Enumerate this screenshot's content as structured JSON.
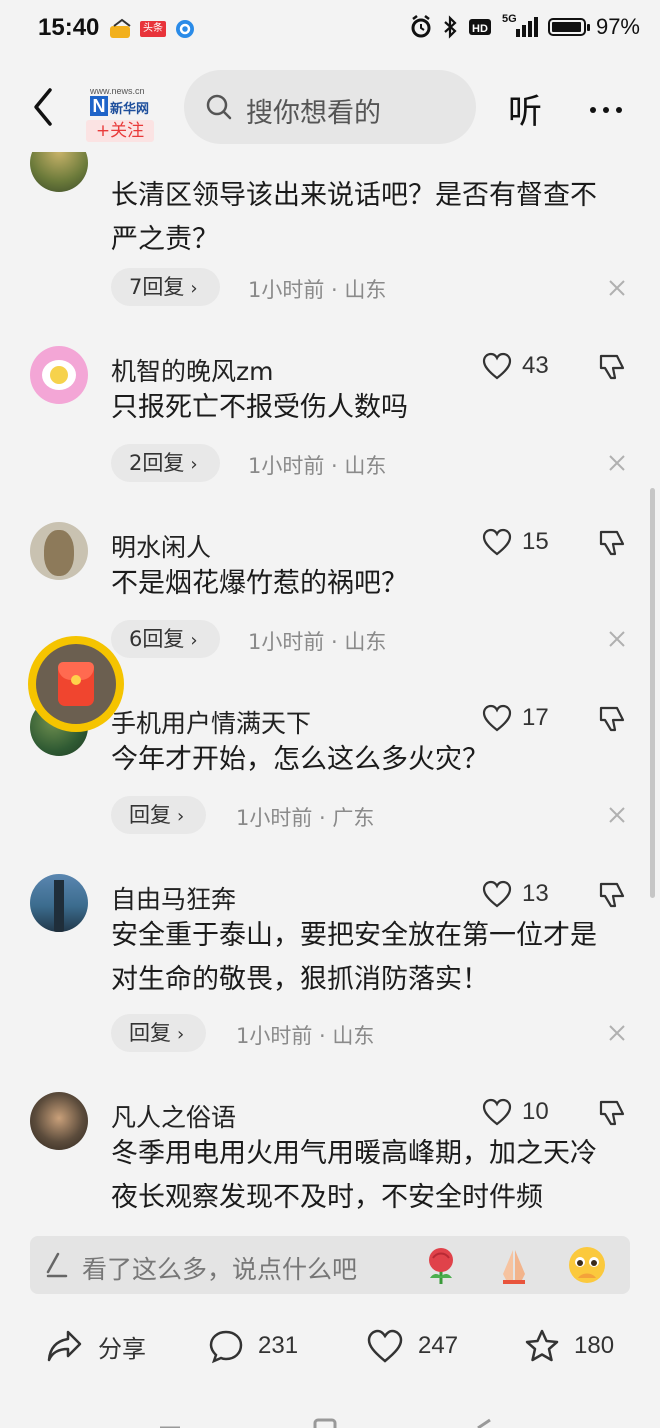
{
  "status_bar": {
    "time": "15:40",
    "notification_badge": "头条",
    "network": "5G",
    "battery_percent": "97%",
    "icons": [
      "app-notification-icon",
      "toutiao-icon",
      "browser-icon",
      "alarm-icon",
      "bluetooth-icon",
      "hd-icon",
      "signal-icon",
      "battery-icon"
    ]
  },
  "header": {
    "logo": {
      "site": "www.news.cn",
      "letter": "N",
      "name": "新华网"
    },
    "follow_label": "+关注",
    "search_placeholder": "搜你想看的",
    "listen_label": "听"
  },
  "comments": [
    {
      "name": "",
      "likes": "",
      "text": "长清区领导该出来说话吧？是否有督查不严之责？",
      "replies": "7回复",
      "time_location": "1小时前 · 山东",
      "avatar_color": "#8a7a3a"
    },
    {
      "name": "机智的晚风zm",
      "likes": "43",
      "text": "只报死亡不报受伤人数吗",
      "replies": "2回复",
      "time_location": "1小时前 · 山东",
      "avatar_color": "#f3a6d6"
    },
    {
      "name": "明水闲人",
      "likes": "15",
      "text": "不是烟花爆竹惹的祸吧？",
      "replies": "6回复",
      "time_location": "1小时前 · 山东",
      "avatar_color": "#a39d8b"
    },
    {
      "name": "手机用户情满天下",
      "likes": "17",
      "text": "今年才开始，怎么这么多火灾？",
      "replies": "回复",
      "time_location": "1小时前 · 广东",
      "avatar_color": "#2f5a33"
    },
    {
      "name": "自由马狂奔",
      "likes": "13",
      "text": "安全重于泰山，要把安全放在第一位才是对生命的敬畏，狠抓消防落实！",
      "replies": "回复",
      "time_location": "1小时前 · 山东",
      "avatar_color": "#3c6c8e"
    },
    {
      "name": "凡人之俗语",
      "likes": "10",
      "text": "冬季用电用火用气用暖高峰期，加之天冷夜长观察发现不及时，不安全时件频",
      "replies": "",
      "time_location": "",
      "avatar_color": "#5c4c3c"
    }
  ],
  "comment_input": {
    "placeholder": "看了这么多，说点什么吧",
    "emojis": [
      "rose-emoji-icon",
      "praying-hands-emoji-icon",
      "pleading-face-emoji-icon"
    ]
  },
  "actions": {
    "share_label": "分享",
    "comments_count": "231",
    "likes_count": "247",
    "favorites_count": "180"
  },
  "colors": {
    "accent_red": "#e83a3a",
    "brand_blue": "#1e64c8",
    "background": "#f3f3f3"
  }
}
